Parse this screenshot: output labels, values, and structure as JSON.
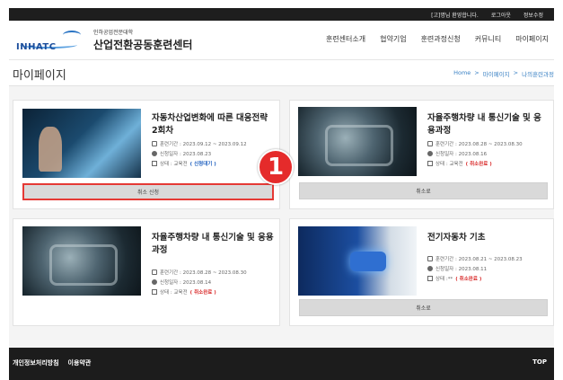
{
  "topbar": {
    "user": "[고]명님 환영합니다.",
    "logout": "로그아웃",
    "myinfo": "정보수정"
  },
  "header": {
    "logo_word": "INHATC",
    "logo_sub": "인하공업전문대학",
    "logo_main": "산업전환공동훈련센터",
    "nav": [
      "훈련센터소개",
      "협약기업",
      "훈련과정신청",
      "커뮤니티",
      "마이페이지"
    ]
  },
  "page": {
    "title": "마이페이지",
    "breadcrumb": [
      "Home",
      ">",
      "마이페이지",
      ">",
      "나의훈련과정"
    ]
  },
  "cards": [
    {
      "title": "자동차산업변화에 따른 대응전략 2회차",
      "period": "훈련기간 : 2023.09.12 ~ 2023.09.12",
      "apply_date": "신청일자 : 2023.08.23",
      "status_prefix": "상태 : 교육전 ",
      "status_value": "( 신청대기 )",
      "button": "취소 신청",
      "image": "car-tech-image"
    },
    {
      "title": "자율주행차량 내 통신기술 및 응용과정",
      "period": "훈련기간 : 2023.08.28 ~ 2023.08.30",
      "apply_date": "신청일자 : 2023.08.16",
      "status_prefix": "상태 : 교육전 ",
      "status_value": "( 취소완료 )",
      "button": "취소료",
      "image": "engine-image"
    },
    {
      "title": "자율주행차량 내 통신기술 및 응용과정",
      "period": "훈련기간 : 2023.08.28 ~ 2023.08.30",
      "apply_date": "신청일자 : 2023.08.14",
      "status_prefix": "상태 : 교육전 ",
      "status_value": "( 취소완료 )",
      "button": "",
      "image": "engine-image"
    },
    {
      "title": "전기자동차 기초",
      "period": "훈련기간 : 2023.08.21 ~ 2023.08.23",
      "apply_date": "신청일자 : 2023.08.11",
      "status_prefix": "상태 :** ",
      "status_value": "( 취소완료 )",
      "button": "취소료",
      "image": "ev-charging-image"
    }
  ],
  "annotation": {
    "badge": "1"
  },
  "footer": {
    "privacy": "개인정보처리방침",
    "terms": "이용약관",
    "top": "TOP"
  },
  "colors": {
    "accent_red": "#e52b2b",
    "link_blue": "#3b82c4",
    "footer_bg": "#1c1c1c"
  }
}
